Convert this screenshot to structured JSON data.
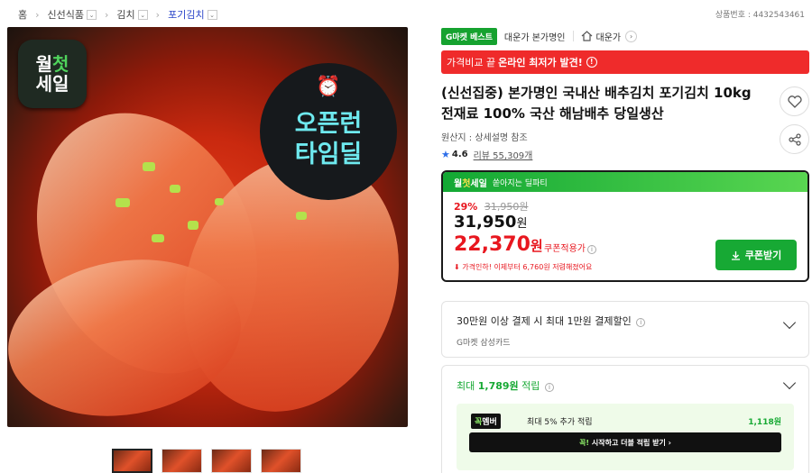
{
  "breadcrumb": {
    "home": "홈",
    "items": [
      "신선식품",
      "김치",
      "포기김치"
    ],
    "dropdown_glyph": "⌄"
  },
  "product_id": "상품번호 : 4432543461",
  "image": {
    "badge_wol": [
      "월",
      "첫",
      "세일"
    ],
    "badge_time": [
      "오픈런",
      "타임딜"
    ]
  },
  "thumbs_count": 4,
  "tags": {
    "best": "G마켓 베스트",
    "seller": "대운가 본가명인",
    "store": "대운가"
  },
  "banner": {
    "prefix": "가격비교 끝",
    "emphasis": "온라인 최저가 발견!",
    "info": "!"
  },
  "title": "(신선집중) 본가명인 국내산 배추김치 포기김치 10kg 전재료 100% 국산 해남배추 당일생산",
  "origin": "원산지 : 상세설명 참조",
  "rating": {
    "score": "4.6",
    "reviews": "리뷰 55,309개"
  },
  "deal": {
    "header_prefix": "월",
    "header_highlight": "첫",
    "header_suffix": "세일",
    "header_sub": "쏟아지는 딜파티",
    "discount_pct": "29%",
    "original_price": "31,950원",
    "price_num": "31,950",
    "price_unit": "원",
    "coupon_price_num": "22,370",
    "coupon_price_unit": "원",
    "coupon_label": "쿠폰적용가",
    "notice": "가격인하! 이제부터 6,760원 저렴해졌어요",
    "coupon_button": "쿠폰받기"
  },
  "card_payment": {
    "title": "30만원 이상 결제 시 최대 1만원 결제할인",
    "sub": "G마켓 삼성카드"
  },
  "card_points": {
    "title_prefix": "최대",
    "title_amount": "1,789원",
    "title_suffix": "적립",
    "member_badge_1": "꼭",
    "member_badge_2": "멤버",
    "member_text": "최대 5% 추가 적립",
    "member_points": "1,118원",
    "member_button_1": "꼭!",
    "member_button_2": "시작하고 더블 적립 받기",
    "member_button_3": "›"
  },
  "colors": {
    "accent_green": "#17a934",
    "sale_red": "#e8171f",
    "link_blue": "#2a44c8",
    "rating_blue": "#2c6ee9"
  },
  "icons": {
    "heart": "heart-icon",
    "share": "share-icon",
    "home": "home-icon",
    "star": "star-icon",
    "download": "download-icon"
  }
}
